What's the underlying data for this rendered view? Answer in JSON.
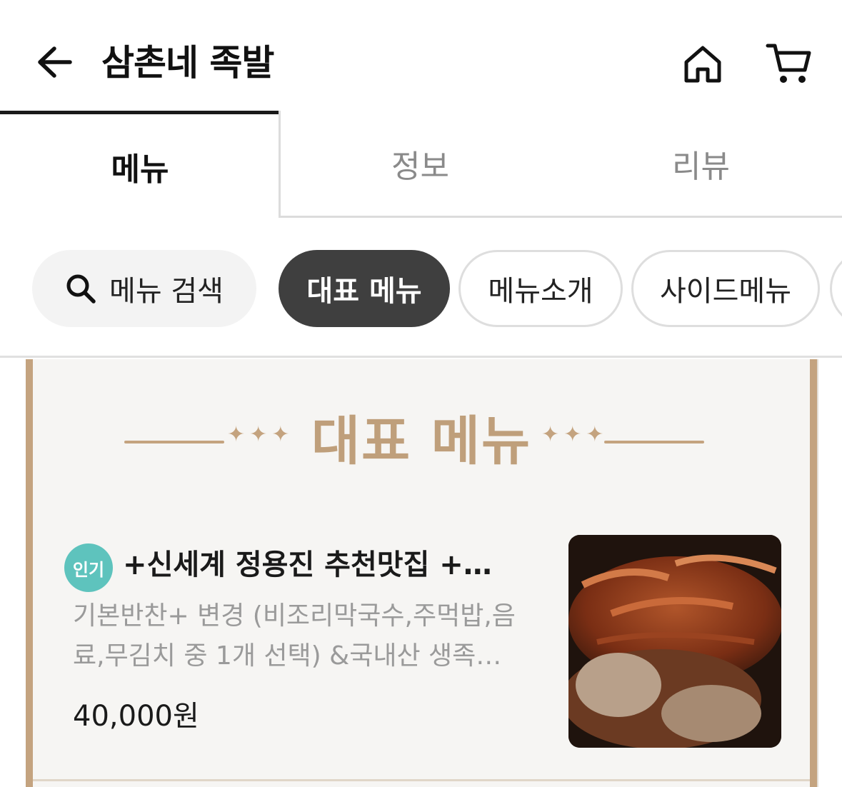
{
  "header": {
    "title": "삼촌네 족발",
    "back_icon": "arrow-left-icon",
    "home_icon": "home-icon",
    "cart_icon": "cart-icon"
  },
  "tabs": [
    {
      "label": "메뉴",
      "active": true
    },
    {
      "label": "정보",
      "active": false
    },
    {
      "label": "리뷰",
      "active": false
    }
  ],
  "filters": {
    "search_label": "메뉴 검색",
    "chips": [
      {
        "label": "대표 메뉴",
        "selected": true
      },
      {
        "label": "메뉴소개",
        "selected": false
      },
      {
        "label": "사이드메뉴",
        "selected": false
      }
    ]
  },
  "section": {
    "title": "대표 메뉴",
    "accent_color": "#c4a37f"
  },
  "items": [
    {
      "badge": "인기",
      "name": "+신세계 정용진 추천맛집 +…",
      "description": "기본반찬+ 변경 (비조리막국수,주먹밥,음료,무김치  중 1개 선택) &국내산 생족…",
      "price": "40,000원"
    }
  ],
  "colors": {
    "badge": "#5ec3bd",
    "selected_chip": "#3f3f3f",
    "frame": "#c4a37f"
  }
}
